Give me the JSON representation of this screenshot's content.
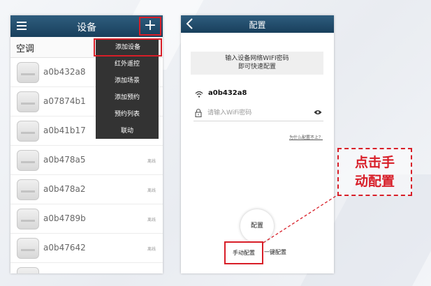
{
  "phone1": {
    "title": "设备",
    "add_button": "+",
    "category": "空调",
    "devices": [
      {
        "name": "a0b432a8",
        "status": ""
      },
      {
        "name": "a07874b1",
        "status": ""
      },
      {
        "name": "a0b41b17",
        "status": ""
      },
      {
        "name": "a0b478a5",
        "status": "离线"
      },
      {
        "name": "a0b478a2",
        "status": "离线"
      },
      {
        "name": "a0b4789b",
        "status": "离线"
      },
      {
        "name": "a0b47642",
        "status": "离线"
      },
      {
        "name": "",
        "status": ""
      }
    ],
    "menu": [
      "添加设备",
      "红外遥控",
      "添加场景",
      "添加预约",
      "预约列表",
      "联动"
    ]
  },
  "phone2": {
    "title": "配置",
    "hint_line1": "输入设备网络WIFI密码",
    "hint_line2": "即可快速配置",
    "ssid": "a0b432a8",
    "password_placeholder": "请输入WiFi密码",
    "why_link": "为什么配置不上？",
    "config_button": "配置",
    "manual_button": "手动配置",
    "onekey_button": "一键配置"
  },
  "annotation": {
    "line1": "点击手",
    "line2": "动配置"
  },
  "colors": {
    "header": "#234b6b",
    "highlight": "#d81e28",
    "menu_bg": "#333333"
  }
}
